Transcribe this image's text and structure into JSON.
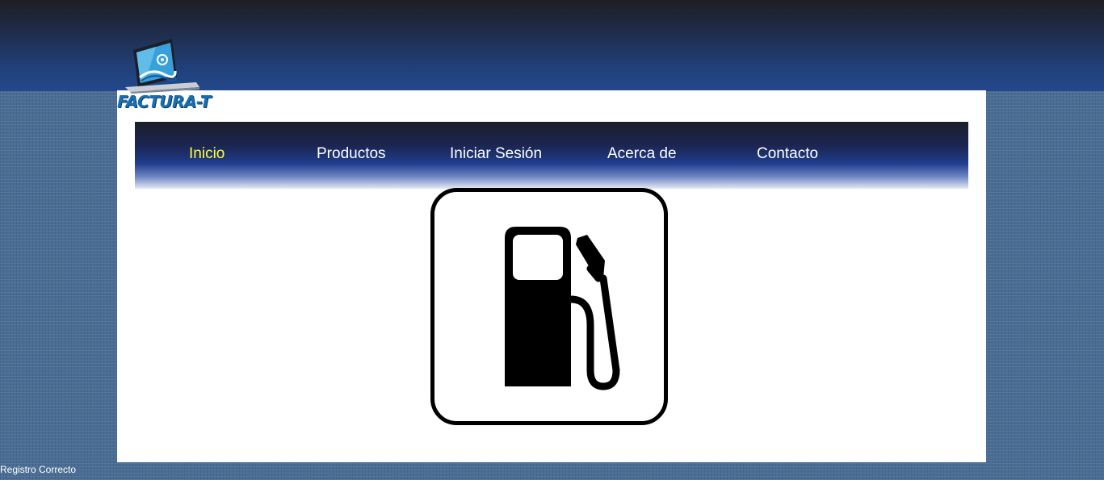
{
  "branding": {
    "logo_text": "FACTURA-T"
  },
  "nav": {
    "items": [
      {
        "label": "Inicio",
        "active": true
      },
      {
        "label": "Productos",
        "active": false
      },
      {
        "label": "Iniciar Sesión",
        "active": false
      },
      {
        "label": "Acerca de",
        "active": false
      },
      {
        "label": "Contacto",
        "active": false
      }
    ]
  },
  "main": {
    "image_icon": "fuel-pump-icon"
  },
  "footer": {
    "status": "Registro Correcto"
  },
  "colors": {
    "nav_active": "#ffff33",
    "nav_text": "#ffffff",
    "header_blue": "#23488c",
    "background": "#4a6d93"
  }
}
